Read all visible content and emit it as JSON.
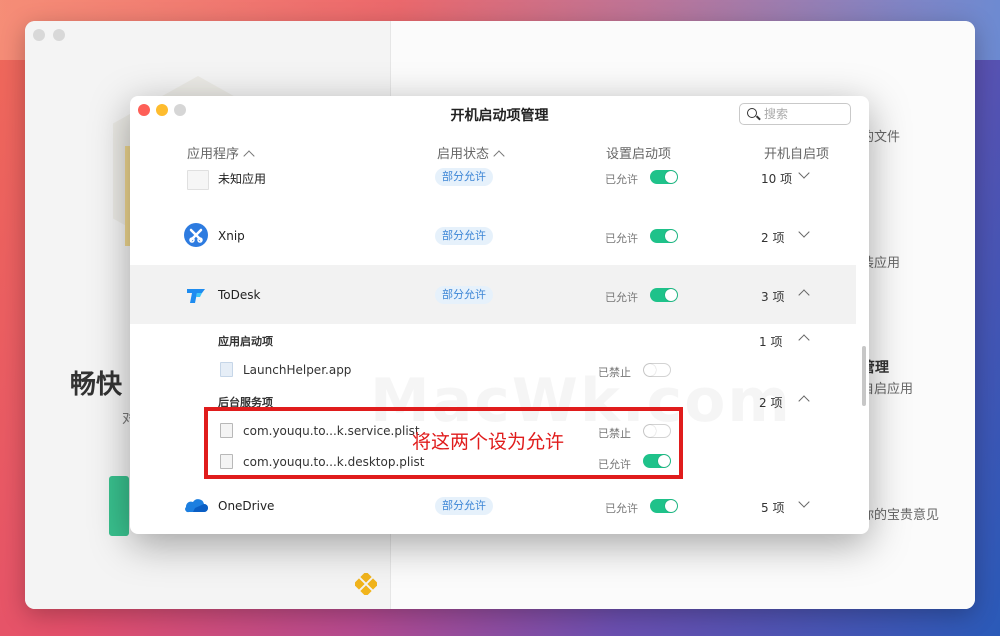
{
  "window": {
    "title": "开机启动项管理",
    "search_placeholder": "搜索"
  },
  "columns": {
    "app": "应用程序",
    "status": "启用状态",
    "setting": "设置启动项",
    "autostart": "开机自启项"
  },
  "rows": [
    {
      "name": "未知应用",
      "badge": "部分允许",
      "state": "已允许",
      "toggle": "on",
      "count": "10 项",
      "expanded": false,
      "icon": "blank-app-icon"
    },
    {
      "name": "Xnip",
      "badge": "部分允许",
      "state": "已允许",
      "toggle": "on",
      "count": "2 项",
      "expanded": false,
      "icon": "xnip-app-icon"
    },
    {
      "name": "ToDesk",
      "badge": "部分允许",
      "state": "已允许",
      "toggle": "on",
      "count": "3 项",
      "expanded": true,
      "icon": "todesk-app-icon"
    },
    {
      "name": "OneDrive",
      "badge": "部分允许",
      "state": "已允许",
      "toggle": "on",
      "count": "5 项",
      "expanded": false,
      "icon": "onedrive-cloud-icon"
    }
  ],
  "todesk_details": {
    "launch_items_label": "应用启动项",
    "launch_items_count": "1 项",
    "launch_items": [
      {
        "name": "LaunchHelper.app",
        "state": "已禁止",
        "toggle": "off"
      }
    ],
    "background_label": "后台服务项",
    "background_count": "2 项",
    "background_items": [
      {
        "name": "com.youqu.to...k.service.plist",
        "state": "已禁止",
        "toggle": "off"
      },
      {
        "name": "com.youqu.to...k.desktop.plist",
        "state": "已允许",
        "toggle": "on"
      }
    ]
  },
  "annotation": "将这两个设为允许",
  "watermark": "MacWk.com",
  "background_window": {
    "hero_title": "畅快",
    "hero_sub": "对",
    "right_texts": [
      "理",
      "的文件",
      "装应用",
      "管理",
      "自启应用",
      "你的宝贵意见"
    ]
  },
  "colors": {
    "toggle_on": "#1fc28a",
    "badge_text": "#3d86d6",
    "badge_bg": "#e6f1fb",
    "annotation": "#e01c1c"
  }
}
